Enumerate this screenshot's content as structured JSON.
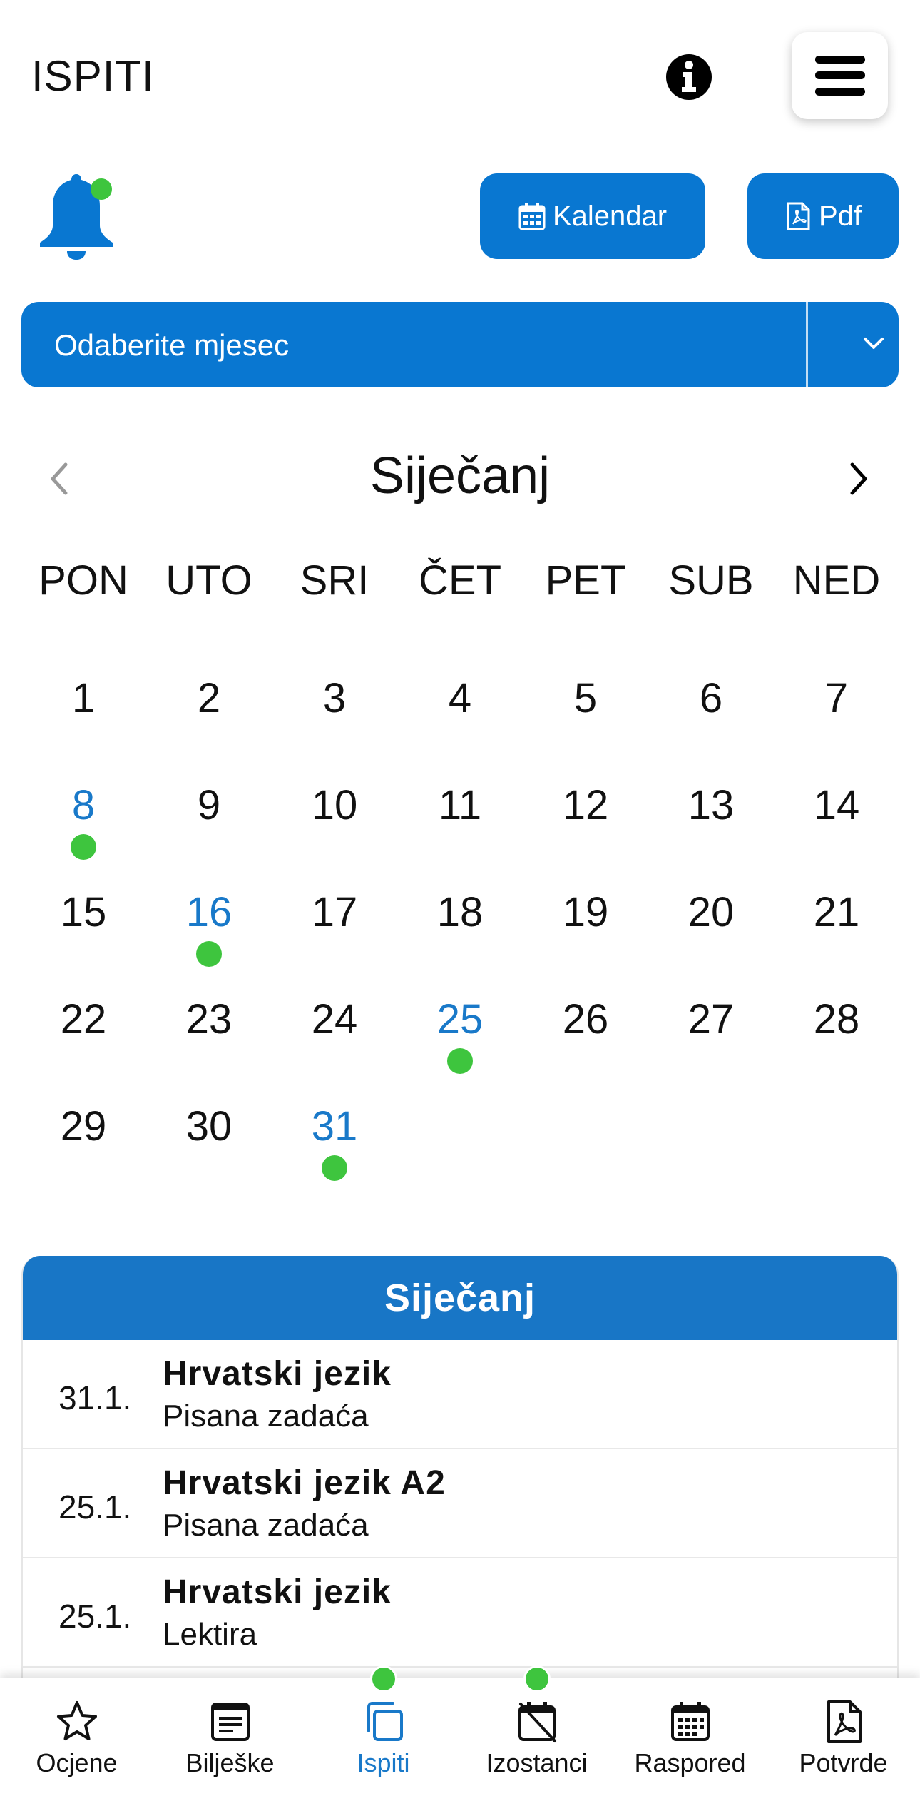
{
  "header": {
    "title": "ISPITI",
    "info_icon": "info-circle-icon",
    "menu_icon": "hamburger-menu-icon"
  },
  "notifications": {
    "icon": "bell-icon",
    "has_unread": true
  },
  "toolbar": {
    "calendar_label": "Kalendar",
    "calendar_icon": "calendar-icon",
    "pdf_label": "Pdf",
    "pdf_icon": "file-pdf-icon"
  },
  "month_select": {
    "placeholder": "Odaberite mjesec",
    "icon": "chevron-down-icon"
  },
  "calendar": {
    "month": "Siječanj",
    "weekdays": [
      "PON",
      "UTO",
      "SRI",
      "ČET",
      "PET",
      "SUB",
      "NED"
    ],
    "days": [
      1,
      2,
      3,
      4,
      5,
      6,
      7,
      8,
      9,
      10,
      11,
      12,
      13,
      14,
      15,
      16,
      17,
      18,
      19,
      20,
      21,
      22,
      23,
      24,
      25,
      26,
      27,
      28,
      29,
      30,
      31
    ],
    "exam_days": [
      8,
      16,
      25,
      31
    ]
  },
  "exam_list": {
    "title": "Siječanj",
    "items": [
      {
        "date": "31.1.",
        "subject": "Hrvatski jezik",
        "type": "Pisana zadaća"
      },
      {
        "date": "25.1.",
        "subject": "Hrvatski jezik A2",
        "type": "Pisana zadaća"
      },
      {
        "date": "25.1.",
        "subject": "Hrvatski jezik",
        "type": "Lektira"
      }
    ]
  },
  "bottom_nav": {
    "items": [
      {
        "label": "Ocjene",
        "icon": "star-icon",
        "active": false,
        "badge": false
      },
      {
        "label": "Bilješke",
        "icon": "notes-icon",
        "active": false,
        "badge": false
      },
      {
        "label": "Ispiti",
        "icon": "copy-icon",
        "active": true,
        "badge": true
      },
      {
        "label": "Izostanci",
        "icon": "calendar-off-icon",
        "active": false,
        "badge": true
      },
      {
        "label": "Raspored",
        "icon": "calendar-grid-icon",
        "active": false,
        "badge": false
      },
      {
        "label": "Potvrde",
        "icon": "file-pdf-icon",
        "active": false,
        "badge": false
      }
    ]
  },
  "colors": {
    "accent": "#0977d1",
    "exam_day": "#1979c9",
    "dot": "#3ec53e"
  }
}
